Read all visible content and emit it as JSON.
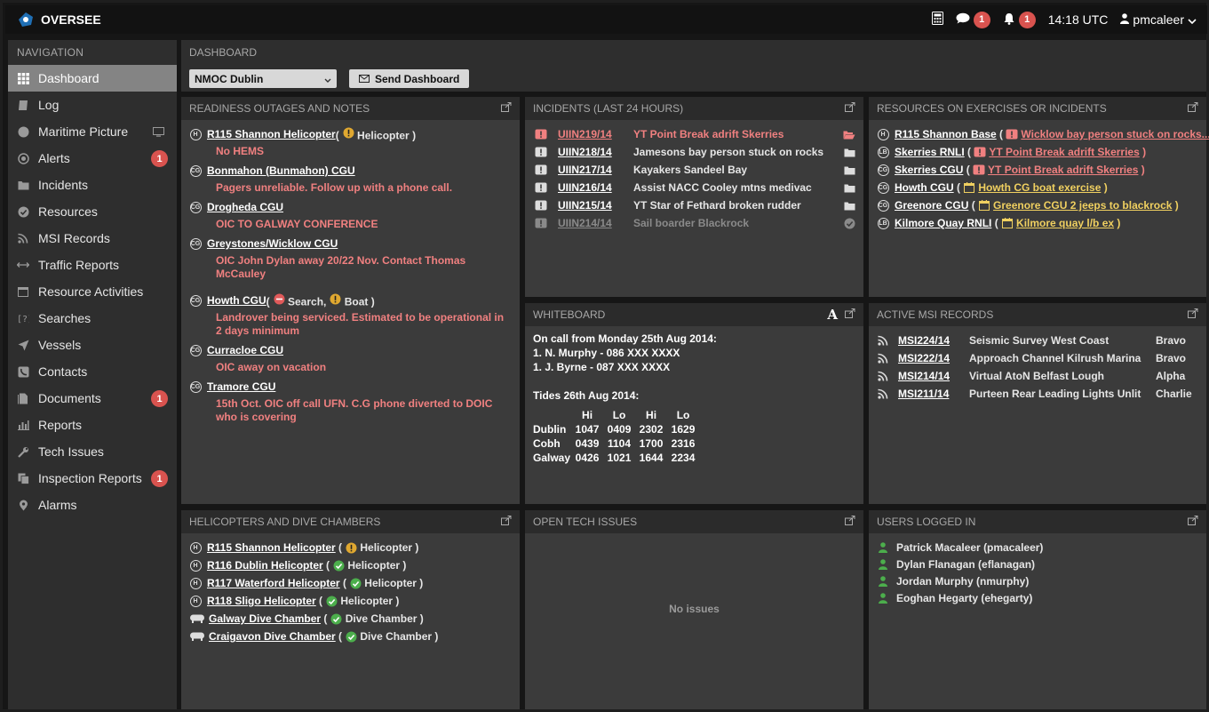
{
  "app": {
    "name": "OVERSEE",
    "time": "14:18 UTC",
    "user": "pmcaleer",
    "chat_count": "1",
    "alert_count": "1"
  },
  "colors": {
    "accent": "#d9534f",
    "link_red": "#f08080",
    "link_yellow": "#f0d060",
    "ok": "#4cae4c",
    "warn": "#e0a830"
  },
  "nav": {
    "heading": "NAVIGATION",
    "items": [
      {
        "label": "Dashboard",
        "icon": "grid-icon",
        "active": true
      },
      {
        "label": "Log",
        "icon": "book-icon"
      },
      {
        "label": "Maritime Picture",
        "icon": "globe-icon",
        "extra": "monitor-icon"
      },
      {
        "label": "Alerts",
        "icon": "target-icon",
        "badge": "1"
      },
      {
        "label": "Incidents",
        "icon": "folder-icon"
      },
      {
        "label": "Resources",
        "icon": "check-circle-icon"
      },
      {
        "label": "MSI Records",
        "icon": "rss-icon"
      },
      {
        "label": "Traffic Reports",
        "icon": "arrows-h-icon"
      },
      {
        "label": "Resource Activities",
        "icon": "calendar-icon"
      },
      {
        "label": "Searches",
        "icon": "question-bracket-icon"
      },
      {
        "label": "Vessels",
        "icon": "send-icon"
      },
      {
        "label": "Contacts",
        "icon": "phone-icon"
      },
      {
        "label": "Documents",
        "icon": "file-icon",
        "badge": "1"
      },
      {
        "label": "Reports",
        "icon": "bar-chart-icon"
      },
      {
        "label": "Tech Issues",
        "icon": "wrench-icon"
      },
      {
        "label": "Inspection Reports",
        "icon": "copy-icon",
        "badge": "1"
      },
      {
        "label": "Alarms",
        "icon": "marker-icon"
      }
    ]
  },
  "dashboard": {
    "heading": "DASHBOARD",
    "location": "NMOC Dublin",
    "send_label": "Send Dashboard"
  },
  "readiness": {
    "title": "READINESS OUTAGES AND NOTES",
    "rows": [
      {
        "name": "R115 Shannon Helicopter",
        "icon": "H",
        "status": "Helicopter",
        "status_icon": "warn",
        "note": "No HEMS"
      },
      {
        "name": "Bonmahon (Bunmahon) CGU",
        "icon": "CG",
        "note": "Pagers unreliable. Follow up with a phone call."
      },
      {
        "name": "Drogheda CGU",
        "icon": "CG",
        "note": "OIC TO GALWAY CONFERENCE"
      },
      {
        "name": "Greystones/Wicklow CGU",
        "icon": "CG",
        "note": "OIC John Dylan away 20/22 Nov. Contact Thomas McCauley"
      },
      {
        "name": "Howth CGU",
        "icon": "CG",
        "status": "Search,",
        "status2": "Boat",
        "note": "Landrover being serviced. Estimated to be operational in 2 days minimum"
      },
      {
        "name": "Curracloe CGU",
        "icon": "CG",
        "note": "OIC away on vacation"
      },
      {
        "name": "Tramore CGU",
        "icon": "CG",
        "note": "15th Oct. OIC off call UFN. C.G phone diverted to DOIC who is covering"
      }
    ]
  },
  "incidents": {
    "title": "INCIDENTS (LAST 24 HOURS)",
    "rows": [
      {
        "id": "UIIN219/14",
        "desc": "YT Point Break adrift Skerries",
        "state": "open-highlight"
      },
      {
        "id": "UIIN218/14",
        "desc": "Jamesons bay person stuck on rocks",
        "state": "open"
      },
      {
        "id": "UIIN217/14",
        "desc": "Kayakers Sandeel Bay",
        "state": "open"
      },
      {
        "id": "UIIN216/14",
        "desc": "Assist NACC Cooley mtns medivac",
        "state": "open"
      },
      {
        "id": "UIIN215/14",
        "desc": "YT Star of Fethard broken rudder",
        "state": "open"
      },
      {
        "id": "UIIN214/14",
        "desc": "Sail boarder Blackrock",
        "state": "closed"
      }
    ]
  },
  "resources": {
    "title": "RESOURCES ON EXERCISES OR INCIDENTS",
    "rows": [
      {
        "name": "R115 Shannon Base",
        "icon": "H",
        "kind": "incident",
        "activity": "Wicklow bay person stuck on rocks..."
      },
      {
        "name": "Skerries RNLI",
        "icon": "LB",
        "kind": "incident",
        "activity": "YT Point Break adrift Skerries"
      },
      {
        "name": "Skerries CGU",
        "icon": "CG",
        "kind": "incident",
        "activity": "YT Point Break adrift Skerries"
      },
      {
        "name": "Howth CGU",
        "icon": "CG",
        "kind": "exercise",
        "activity": "Howth CG boat exercise"
      },
      {
        "name": "Greenore CGU",
        "icon": "CG",
        "kind": "exercise",
        "activity": "Greenore CGU 2 jeeps to blackrock"
      },
      {
        "name": "Kilmore Quay RNLI",
        "icon": "LB",
        "kind": "exercise",
        "activity": "Kilmore quay l/b ex"
      }
    ]
  },
  "whiteboard": {
    "title": "WHITEBOARD",
    "text": "On call from Monday 25th Aug 2014:\n1. N. Murphy - 086 XXX XXXX\n1. J. Byrne - 087 XXX XXXX\n\nTides 26th Aug 2014:",
    "tides": {
      "header": [
        "",
        "Hi",
        "Lo",
        "Hi",
        "Lo"
      ],
      "rows": [
        [
          "Dublin",
          "1047",
          "0409",
          "2302",
          "1629"
        ],
        [
          "Cobh",
          "0439",
          "1104",
          "1700",
          "2316"
        ],
        [
          "Galway",
          "0426",
          "1021",
          "1644",
          "2234"
        ]
      ]
    }
  },
  "msi": {
    "title": "ACTIVE MSI RECORDS",
    "rows": [
      {
        "id": "MSI224/14",
        "desc": "Seismic Survey West Coast",
        "code": "Bravo"
      },
      {
        "id": "MSI222/14",
        "desc": "Approach Channel Kilrush Marina",
        "code": "Bravo"
      },
      {
        "id": "MSI214/14",
        "desc": "Virtual AtoN Belfast Lough",
        "code": "Alpha"
      },
      {
        "id": "MSI211/14",
        "desc": "Purteen Rear Leading Lights Unlit",
        "code": "Charlie"
      }
    ]
  },
  "helicopters": {
    "title": "HELICOPTERS AND DIVE CHAMBERS",
    "rows": [
      {
        "name": "R115 Shannon Helicopter",
        "icon": "H",
        "status": "Helicopter",
        "ok": false
      },
      {
        "name": "R116 Dublin Helicopter",
        "icon": "H",
        "status": "Helicopter",
        "ok": true
      },
      {
        "name": "R117 Waterford Helicopter",
        "icon": "H",
        "status": "Helicopter",
        "ok": true
      },
      {
        "name": "R118 Sligo Helicopter",
        "icon": "H",
        "status": "Helicopter",
        "ok": true
      },
      {
        "name": "Galway Dive Chamber",
        "icon": "chamber",
        "status": "Dive Chamber",
        "ok": true
      },
      {
        "name": "Craigavon Dive Chamber",
        "icon": "chamber",
        "status": "Dive Chamber",
        "ok": true
      }
    ]
  },
  "tech": {
    "title": "OPEN TECH ISSUES",
    "empty": "No issues"
  },
  "users": {
    "title": "USERS LOGGED IN",
    "rows": [
      "Patrick Macaleer (pmacaleer)",
      "Dylan Flanagan (eflanagan)",
      "Jordan Murphy (nmurphy)",
      "Eoghan Hegarty (ehegarty)"
    ]
  }
}
